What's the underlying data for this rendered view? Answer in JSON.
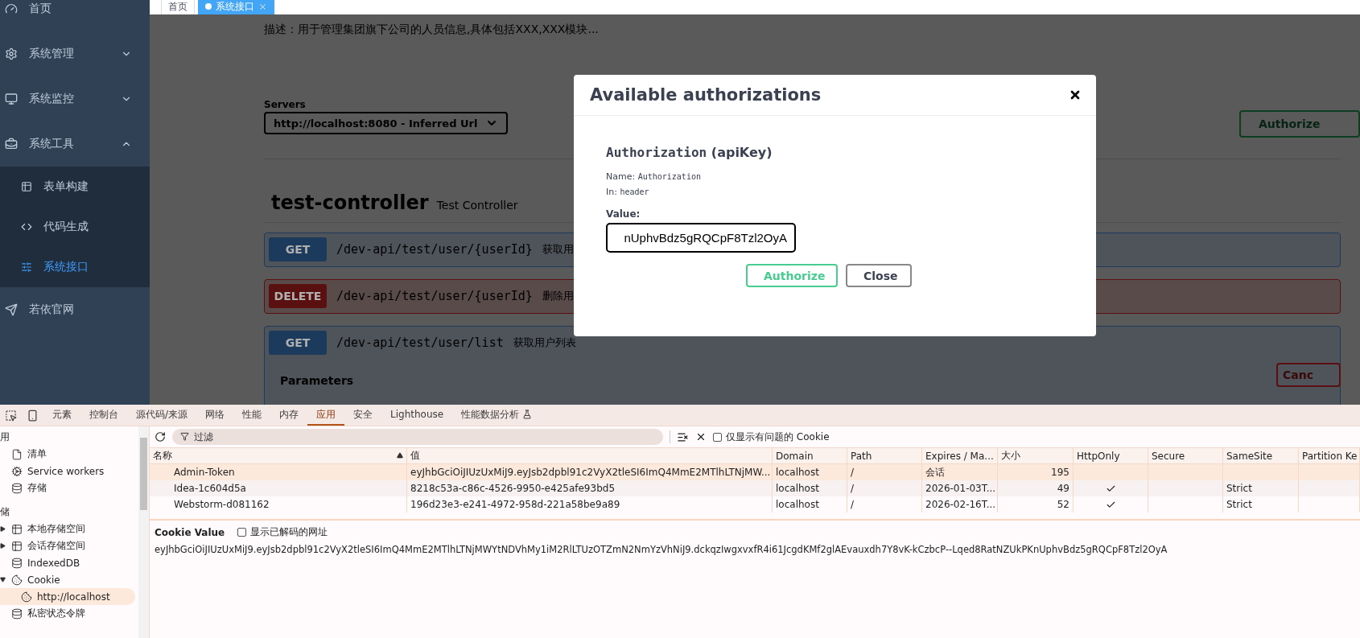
{
  "sidebar": {
    "items": [
      {
        "label": "首页",
        "kind": "link"
      },
      {
        "label": "系统管理",
        "kind": "menu",
        "expanded": false
      },
      {
        "label": "系统监控",
        "kind": "menu",
        "expanded": false
      },
      {
        "label": "系统工具",
        "kind": "menu",
        "expanded": true,
        "children": [
          {
            "label": "表单构建",
            "selected": false
          },
          {
            "label": "代码生成",
            "selected": false
          },
          {
            "label": "系统接口",
            "selected": true
          }
        ]
      },
      {
        "label": "若依官网",
        "kind": "link"
      }
    ]
  },
  "tabs": [
    {
      "label": "首页",
      "selected": false
    },
    {
      "label": "系统接口",
      "selected": true
    }
  ],
  "swagger": {
    "description": "描述：用于管理集团旗下公司的人员信息,具体包括XXX,XXX模块...",
    "servers_label": "Servers",
    "server": "http://localhost:8080 - Inferred Url",
    "authorize_button": "Authorize",
    "tag": {
      "name": "test-controller",
      "description": "Test Controller"
    },
    "operations": [
      {
        "method": "GET",
        "path": "/dev-api/test/user/{userId}",
        "summary": "获取用"
      },
      {
        "method": "DELETE",
        "path": "/dev-api/test/user/{userId}",
        "summary": "删除用"
      },
      {
        "method": "GET",
        "path": "/dev-api/test/user/list",
        "summary": "获取用户列表",
        "expanded": true
      }
    ],
    "parameters_heading": "Parameters",
    "cancel_button": "Canc"
  },
  "modal": {
    "title": "Available authorizations",
    "scheme_name": "Authorization",
    "scheme_type": "(apiKey)",
    "name_label": "Name:",
    "name_value": "Authorization",
    "in_label": "In:",
    "in_value": "header",
    "value_label": "Value:",
    "value": "nUphvBdz5gRQCpF8Tzl2OyA",
    "buttons": [
      {
        "label": "Authorize",
        "kind": "primary"
      },
      {
        "label": "Close",
        "kind": "secondary"
      }
    ]
  },
  "devtools": {
    "tabs": [
      {
        "label": "元素",
        "selected": false
      },
      {
        "label": "控制台",
        "selected": false
      },
      {
        "label": "源代码/来源",
        "selected": false
      },
      {
        "label": "网络",
        "selected": false
      },
      {
        "label": "性能",
        "selected": false
      },
      {
        "label": "内存",
        "selected": false
      },
      {
        "label": "应用",
        "selected": true
      },
      {
        "label": "安全",
        "selected": false
      },
      {
        "label": "Lighthouse",
        "selected": false
      },
      {
        "label": "性能数据分析",
        "selected": false,
        "kind": "experimental"
      }
    ],
    "tree": [
      {
        "header": "用",
        "items": [
          {
            "label": "清单",
            "kind": "file",
            "selected": false
          },
          {
            "label": "Service workers",
            "kind": "gears",
            "selected": false
          },
          {
            "label": "存储",
            "kind": "database",
            "selected": false
          }
        ]
      },
      {
        "header": "储",
        "items": [
          {
            "label": "本地存储空间",
            "kind": "table",
            "selected": false,
            "expanded": false
          },
          {
            "label": "会话存储空间",
            "kind": "table",
            "selected": false,
            "expanded": false
          },
          {
            "label": "IndexedDB",
            "kind": "database",
            "selected": false
          },
          {
            "label": "Cookie",
            "kind": "cookie",
            "selected": false,
            "expanded": true,
            "children": [
              {
                "label": "http://localhost",
                "kind": "cookie",
                "selected": true
              }
            ]
          },
          {
            "label": "私密状态令牌",
            "kind": "database",
            "selected": false
          }
        ]
      }
    ],
    "filter_placeholder": "过滤",
    "issues_checkbox": {
      "label": "仅显示有问题的 Cookie",
      "checked": false
    },
    "columns": [
      {
        "label": "名称",
        "sorted": true
      },
      {
        "label": "值",
        "sorted": false
      },
      {
        "label": "Domain",
        "sorted": false
      },
      {
        "label": "Path",
        "sorted": false
      },
      {
        "label": "Expires / Ma...",
        "sorted": false
      },
      {
        "label": "大小",
        "sorted": false
      },
      {
        "label": "HttpOnly",
        "sorted": false
      },
      {
        "label": "Secure",
        "sorted": false
      },
      {
        "label": "SameSite",
        "sorted": false
      },
      {
        "label": "Partition Ke",
        "sorted": false
      }
    ],
    "rows": [
      {
        "name": "Admin-Token",
        "value": "eyJhbGciOiJIUzUxMiJ9.eyJsb2dpbl91c2VyX2tleSI6ImQ4MmE2MTlhLTNjMW...",
        "domain": "localhost",
        "path": "/",
        "expires": "会话",
        "size": "195",
        "http_only": false,
        "selected": true
      },
      {
        "name": "Idea-1c604d5a",
        "value": "8218c53a-c86c-4526-9950-e425afe93bd5",
        "domain": "localhost",
        "path": "/",
        "expires": "2026-01-03T...",
        "size": "49",
        "http_only": true,
        "same_site": "Strict",
        "selected": false
      },
      {
        "name": "Webstorm-d081162",
        "value": "196d23e3-e241-4972-958d-221a58be9a89",
        "domain": "localhost",
        "path": "/",
        "expires": "2026-02-16T...",
        "size": "52",
        "http_only": true,
        "same_site": "Strict",
        "selected": false
      }
    ],
    "cookie_value": {
      "title": "Cookie Value",
      "decode_checkbox": {
        "label": "显示已解码的网址",
        "checked": false
      },
      "value": "eyJhbGciOiJIUzUxMiJ9.eyJsb2dpbl91c2VyX2tleSI6ImQ4MmE2MTlhLTNjMWYtNDVhMy1iM2RlLTUzOTZmN2NmYzVhNiJ9.dckqzIwgxvxfR4i61JcgdKMf2glAEvauxdh7Y8vK-kCzbcP--Lqed8RatNZUkPKnUphvBdz5gRQCpF8Tzl2OyA"
    }
  }
}
